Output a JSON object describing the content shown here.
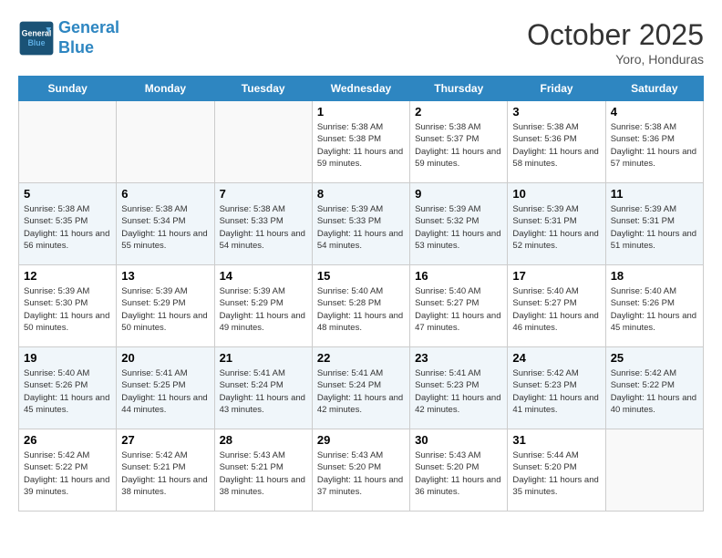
{
  "header": {
    "logo_line1": "General",
    "logo_line2": "Blue",
    "month": "October 2025",
    "location": "Yoro, Honduras"
  },
  "weekdays": [
    "Sunday",
    "Monday",
    "Tuesday",
    "Wednesday",
    "Thursday",
    "Friday",
    "Saturday"
  ],
  "weeks": [
    [
      {
        "day": "",
        "info": ""
      },
      {
        "day": "",
        "info": ""
      },
      {
        "day": "",
        "info": ""
      },
      {
        "day": "1",
        "info": "Sunrise: 5:38 AM\nSunset: 5:38 PM\nDaylight: 11 hours\nand 59 minutes."
      },
      {
        "day": "2",
        "info": "Sunrise: 5:38 AM\nSunset: 5:37 PM\nDaylight: 11 hours\nand 59 minutes."
      },
      {
        "day": "3",
        "info": "Sunrise: 5:38 AM\nSunset: 5:36 PM\nDaylight: 11 hours\nand 58 minutes."
      },
      {
        "day": "4",
        "info": "Sunrise: 5:38 AM\nSunset: 5:36 PM\nDaylight: 11 hours\nand 57 minutes."
      }
    ],
    [
      {
        "day": "5",
        "info": "Sunrise: 5:38 AM\nSunset: 5:35 PM\nDaylight: 11 hours\nand 56 minutes."
      },
      {
        "day": "6",
        "info": "Sunrise: 5:38 AM\nSunset: 5:34 PM\nDaylight: 11 hours\nand 55 minutes."
      },
      {
        "day": "7",
        "info": "Sunrise: 5:38 AM\nSunset: 5:33 PM\nDaylight: 11 hours\nand 54 minutes."
      },
      {
        "day": "8",
        "info": "Sunrise: 5:39 AM\nSunset: 5:33 PM\nDaylight: 11 hours\nand 54 minutes."
      },
      {
        "day": "9",
        "info": "Sunrise: 5:39 AM\nSunset: 5:32 PM\nDaylight: 11 hours\nand 53 minutes."
      },
      {
        "day": "10",
        "info": "Sunrise: 5:39 AM\nSunset: 5:31 PM\nDaylight: 11 hours\nand 52 minutes."
      },
      {
        "day": "11",
        "info": "Sunrise: 5:39 AM\nSunset: 5:31 PM\nDaylight: 11 hours\nand 51 minutes."
      }
    ],
    [
      {
        "day": "12",
        "info": "Sunrise: 5:39 AM\nSunset: 5:30 PM\nDaylight: 11 hours\nand 50 minutes."
      },
      {
        "day": "13",
        "info": "Sunrise: 5:39 AM\nSunset: 5:29 PM\nDaylight: 11 hours\nand 50 minutes."
      },
      {
        "day": "14",
        "info": "Sunrise: 5:39 AM\nSunset: 5:29 PM\nDaylight: 11 hours\nand 49 minutes."
      },
      {
        "day": "15",
        "info": "Sunrise: 5:40 AM\nSunset: 5:28 PM\nDaylight: 11 hours\nand 48 minutes."
      },
      {
        "day": "16",
        "info": "Sunrise: 5:40 AM\nSunset: 5:27 PM\nDaylight: 11 hours\nand 47 minutes."
      },
      {
        "day": "17",
        "info": "Sunrise: 5:40 AM\nSunset: 5:27 PM\nDaylight: 11 hours\nand 46 minutes."
      },
      {
        "day": "18",
        "info": "Sunrise: 5:40 AM\nSunset: 5:26 PM\nDaylight: 11 hours\nand 45 minutes."
      }
    ],
    [
      {
        "day": "19",
        "info": "Sunrise: 5:40 AM\nSunset: 5:26 PM\nDaylight: 11 hours\nand 45 minutes."
      },
      {
        "day": "20",
        "info": "Sunrise: 5:41 AM\nSunset: 5:25 PM\nDaylight: 11 hours\nand 44 minutes."
      },
      {
        "day": "21",
        "info": "Sunrise: 5:41 AM\nSunset: 5:24 PM\nDaylight: 11 hours\nand 43 minutes."
      },
      {
        "day": "22",
        "info": "Sunrise: 5:41 AM\nSunset: 5:24 PM\nDaylight: 11 hours\nand 42 minutes."
      },
      {
        "day": "23",
        "info": "Sunrise: 5:41 AM\nSunset: 5:23 PM\nDaylight: 11 hours\nand 42 minutes."
      },
      {
        "day": "24",
        "info": "Sunrise: 5:42 AM\nSunset: 5:23 PM\nDaylight: 11 hours\nand 41 minutes."
      },
      {
        "day": "25",
        "info": "Sunrise: 5:42 AM\nSunset: 5:22 PM\nDaylight: 11 hours\nand 40 minutes."
      }
    ],
    [
      {
        "day": "26",
        "info": "Sunrise: 5:42 AM\nSunset: 5:22 PM\nDaylight: 11 hours\nand 39 minutes."
      },
      {
        "day": "27",
        "info": "Sunrise: 5:42 AM\nSunset: 5:21 PM\nDaylight: 11 hours\nand 38 minutes."
      },
      {
        "day": "28",
        "info": "Sunrise: 5:43 AM\nSunset: 5:21 PM\nDaylight: 11 hours\nand 38 minutes."
      },
      {
        "day": "29",
        "info": "Sunrise: 5:43 AM\nSunset: 5:20 PM\nDaylight: 11 hours\nand 37 minutes."
      },
      {
        "day": "30",
        "info": "Sunrise: 5:43 AM\nSunset: 5:20 PM\nDaylight: 11 hours\nand 36 minutes."
      },
      {
        "day": "31",
        "info": "Sunrise: 5:44 AM\nSunset: 5:20 PM\nDaylight: 11 hours\nand 35 minutes."
      },
      {
        "day": "",
        "info": ""
      }
    ]
  ]
}
